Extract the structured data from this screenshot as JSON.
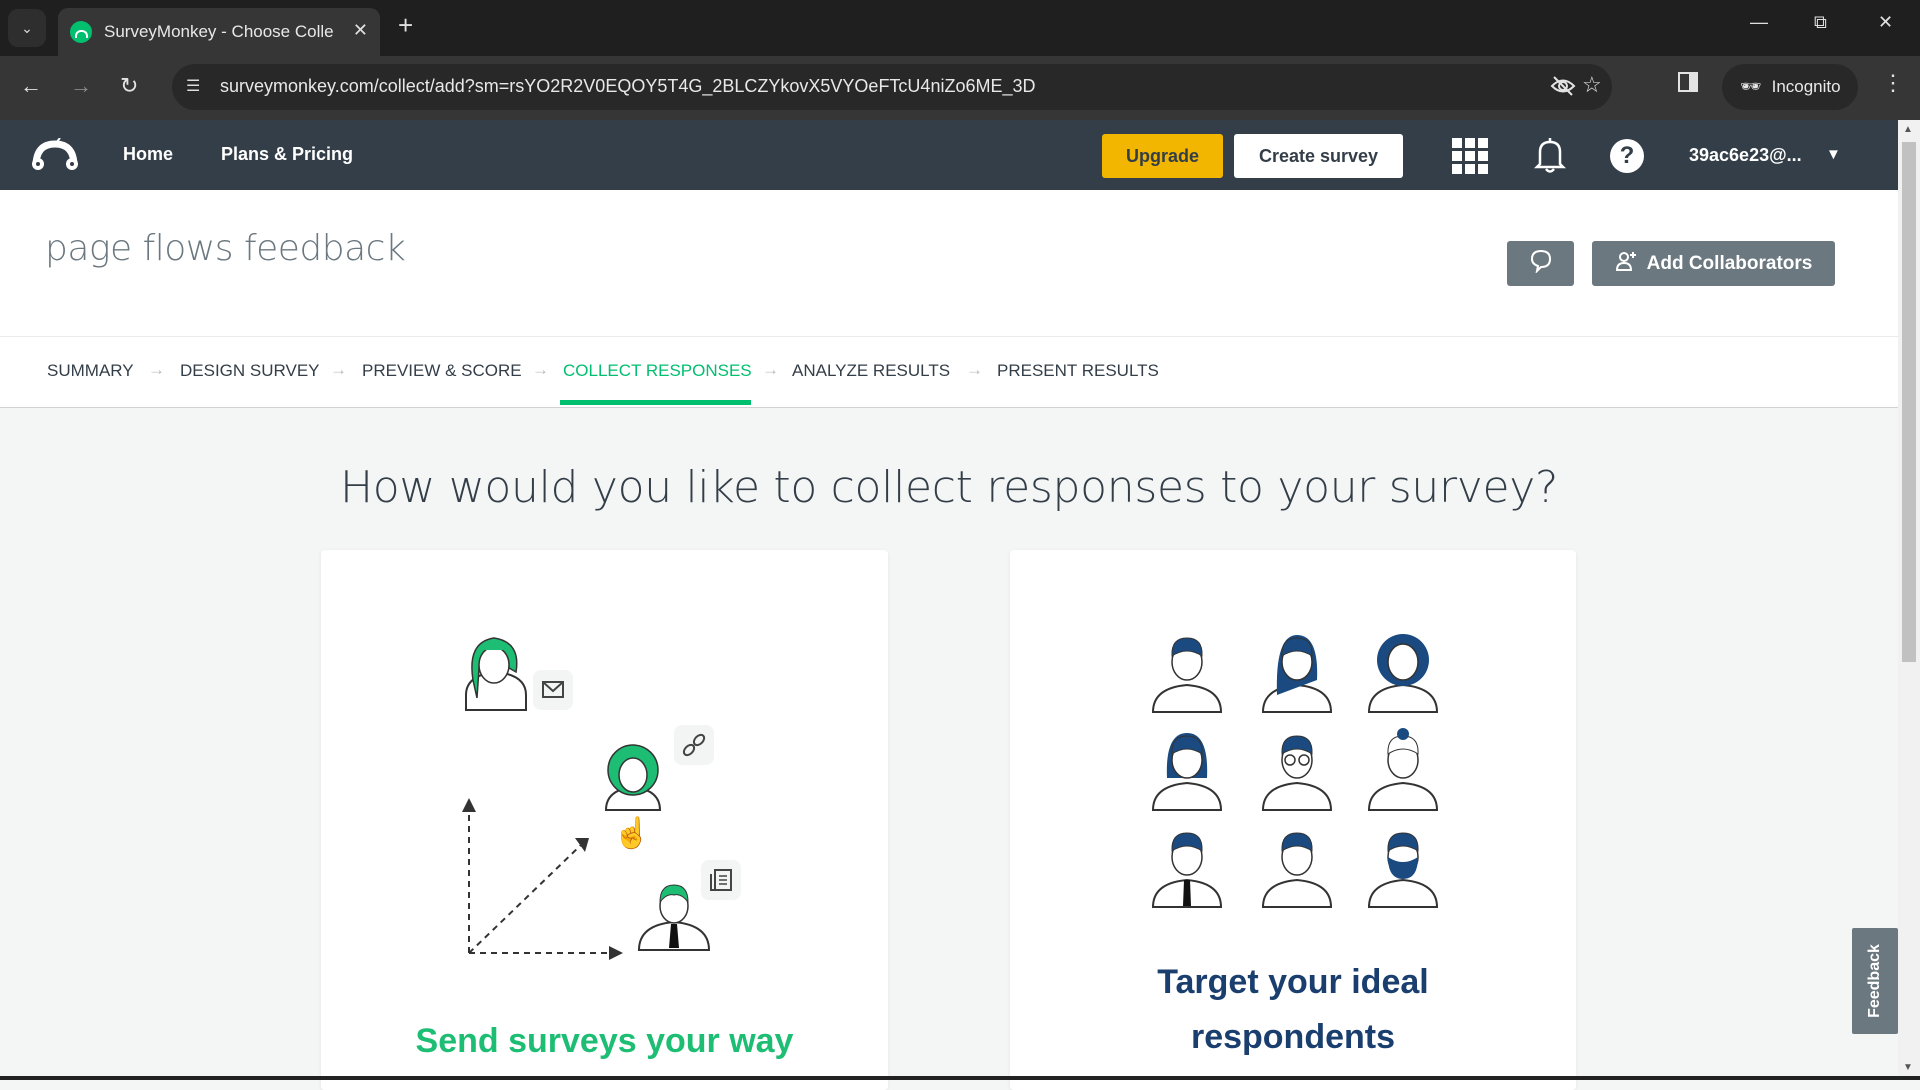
{
  "browser": {
    "tab_title": "SurveyMonkey - Choose Collec",
    "url": "surveymonkey.com/collect/add?sm=rsYO2R2V0EQOY5T4G_2BLCZYkovX5VYOeFTcU4niZo6ME_3D",
    "incognito_label": "Incognito",
    "icons": {
      "tab_list": "chevron-down-icon",
      "close": "close-icon",
      "new_tab": "plus-icon",
      "back": "back-arrow-icon",
      "forward": "forward-arrow-icon",
      "reload": "reload-icon",
      "site_info": "tune-icon",
      "eye_off": "eye-off-icon",
      "bookmark": "star-icon",
      "side_panel": "side-panel-icon",
      "menu": "kebab-menu-icon"
    }
  },
  "nav": {
    "home": "Home",
    "plans_pricing": "Plans & Pricing",
    "upgrade": "Upgrade",
    "create_survey": "Create survey",
    "account": "39ac6e23@...",
    "help_glyph": "?",
    "colors": {
      "nav_bg": "#333e48",
      "upgrade_bg": "#f2b600",
      "brand_green": "#00bf6f"
    }
  },
  "survey": {
    "title": "page flows feedback",
    "add_collaborators": "Add Collaborators"
  },
  "steps": [
    {
      "label": "SUMMARY",
      "active": false
    },
    {
      "label": "DESIGN SURVEY",
      "active": false
    },
    {
      "label": "PREVIEW & SCORE",
      "active": false
    },
    {
      "label": "COLLECT RESPONSES",
      "active": true
    },
    {
      "label": "ANALYZE RESULTS",
      "active": false
    },
    {
      "label": "PRESENT RESULTS",
      "active": false
    }
  ],
  "main": {
    "heading": "How would you like to collect responses to your survey?",
    "cards": [
      {
        "title": "Send surveys your way",
        "illustration": "send-surveys-illustration",
        "color": "#1dbe74"
      },
      {
        "title_line1": "Target your ideal",
        "title_line2": "respondents",
        "illustration": "respondent-avatars-grid",
        "color": "#1a3e6e"
      }
    ]
  },
  "feedback_tab": "Feedback"
}
